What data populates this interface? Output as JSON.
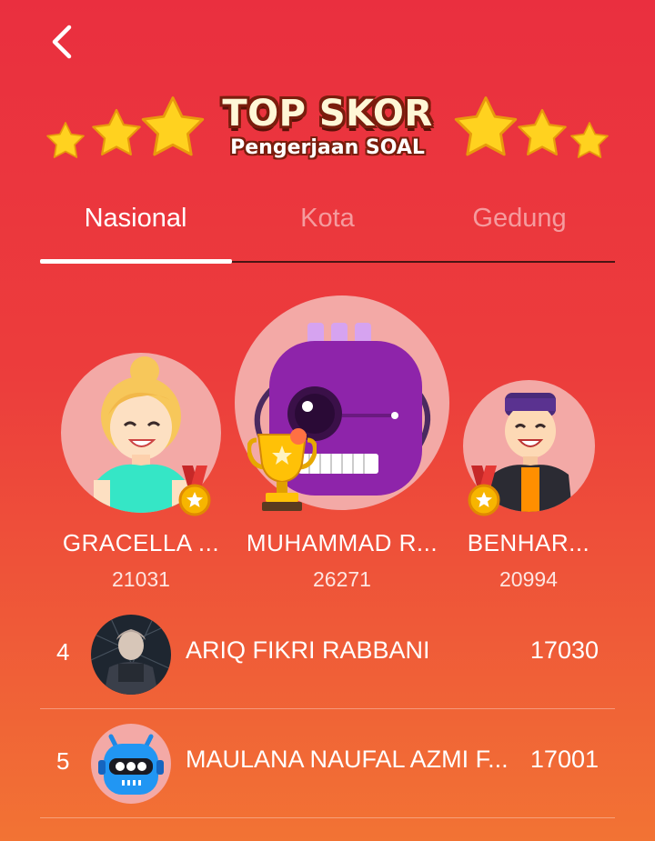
{
  "header": {
    "back_icon": "chevron-left-icon",
    "banner_title": "TOP SKOR",
    "banner_subtitle": "Pengerjaan SOAL"
  },
  "tabs": [
    {
      "label": "Nasional",
      "active": true
    },
    {
      "label": "Kota",
      "active": false
    },
    {
      "label": "Gedung",
      "active": false
    }
  ],
  "podium": {
    "first": {
      "name": "MUHAMMAD R...",
      "score": "26271",
      "badge": "trophy-icon"
    },
    "second": {
      "name": "GRACELLA ...",
      "score": "21031",
      "badge": "medal-icon"
    },
    "third": {
      "name": "BENHAR...",
      "score": "20994",
      "badge": "medal-icon"
    }
  },
  "list": [
    {
      "rank": "4",
      "name": "ARIQ FIKRI RABBANI",
      "score": "17030"
    },
    {
      "rank": "5",
      "name": "MAULANA NAUFAL AZMI F...",
      "score": "17001"
    }
  ],
  "colors": {
    "bg_top": "#ea2f3f",
    "bg_bottom": "#f27334",
    "avatar_bg": "#f3a9a6",
    "star": "#ffd21f"
  }
}
